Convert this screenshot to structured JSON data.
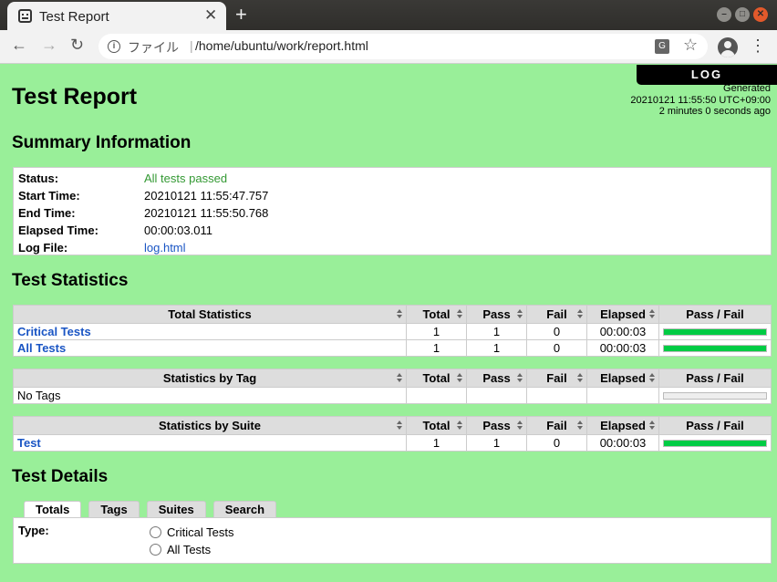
{
  "browser": {
    "tab_title": "Test Report",
    "url_scheme": "ファイル",
    "url_separator": "|",
    "url_path": "/home/ubuntu/work/report.html"
  },
  "header": {
    "log_button": "LOG",
    "generated_label": "Generated",
    "generated_time": "20210121 11:55:50 UTC+09:00",
    "generated_ago": "2 minutes 0 seconds ago",
    "title": "Test Report"
  },
  "summary": {
    "heading": "Summary Information",
    "rows": [
      {
        "key": "Status:",
        "value": "All tests passed"
      },
      {
        "key": "Start Time:",
        "value": "20210121 11:55:47.757"
      },
      {
        "key": "End Time:",
        "value": "20210121 11:55:50.768"
      },
      {
        "key": "Elapsed Time:",
        "value": "00:00:03.011"
      },
      {
        "key": "Log File:",
        "value": "log.html"
      }
    ]
  },
  "statistics": {
    "heading": "Test Statistics",
    "columns": [
      "Total",
      "Pass",
      "Fail",
      "Elapsed",
      "Pass / Fail"
    ],
    "total": {
      "header": "Total Statistics",
      "rows": [
        {
          "name": "Critical Tests",
          "total": "1",
          "pass": "1",
          "fail": "0",
          "elapsed": "00:00:03",
          "pass_pct": 100
        },
        {
          "name": "All Tests",
          "total": "1",
          "pass": "1",
          "fail": "0",
          "elapsed": "00:00:03",
          "pass_pct": 100
        }
      ]
    },
    "tag": {
      "header": "Statistics by Tag",
      "rows": [
        {
          "name": "No Tags",
          "total": "",
          "pass": "",
          "fail": "",
          "elapsed": "",
          "pass_pct": 0
        }
      ]
    },
    "suite": {
      "header": "Statistics by Suite",
      "rows": [
        {
          "name": "Test",
          "total": "1",
          "pass": "1",
          "fail": "0",
          "elapsed": "00:00:03",
          "pass_pct": 100
        }
      ]
    }
  },
  "details": {
    "heading": "Test Details",
    "tabs": [
      "Totals",
      "Tags",
      "Suites",
      "Search"
    ],
    "type_label": "Type:",
    "options": [
      "Critical Tests",
      "All Tests"
    ]
  },
  "colors": {
    "page_bg": "#99ef99",
    "pass_bar": "#00cc44",
    "link": "#1a55c4"
  }
}
